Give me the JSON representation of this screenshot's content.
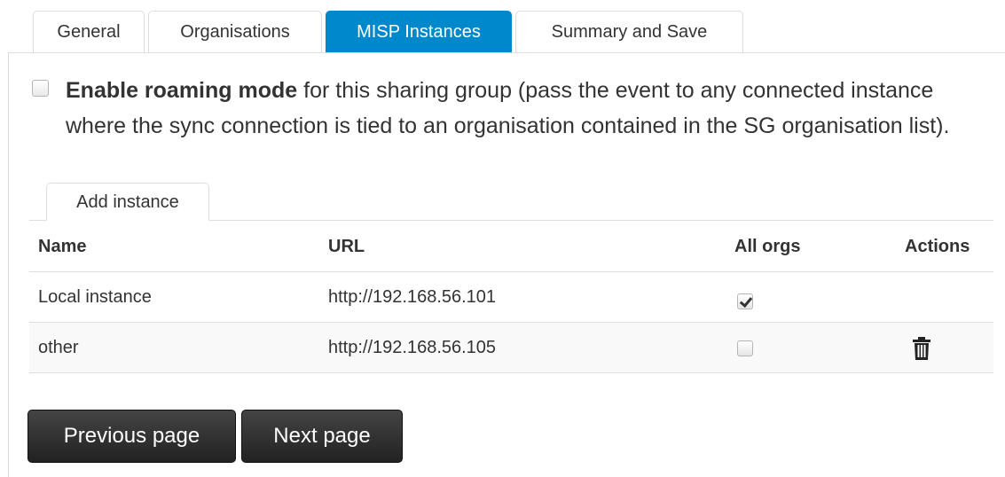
{
  "tabs": [
    {
      "label": "General",
      "active": false
    },
    {
      "label": "Organisations",
      "active": false
    },
    {
      "label": "MISP Instances",
      "active": true
    },
    {
      "label": "Summary and Save",
      "active": false
    }
  ],
  "roaming": {
    "checked": false,
    "bold_label": "Enable roaming mode",
    "description": "for this sharing group (pass the event to any connected instance where the sync connection is tied to an organisation contained in the SG organisation list)."
  },
  "add_instance_tab": "Add instance",
  "table": {
    "headers": {
      "name": "Name",
      "url": "URL",
      "all_orgs": "All orgs",
      "actions": "Actions"
    },
    "rows": [
      {
        "name": "Local instance",
        "url": "http://192.168.56.101",
        "all_orgs": true,
        "deletable": false
      },
      {
        "name": "other",
        "url": "http://192.168.56.105",
        "all_orgs": false,
        "deletable": true
      }
    ]
  },
  "buttons": {
    "previous": "Previous page",
    "next": "Next page"
  },
  "colors": {
    "accent": "#0088cc",
    "button_dark": "#222222"
  },
  "icons": {
    "delete": "trash-icon",
    "check": "checkmark-icon"
  }
}
